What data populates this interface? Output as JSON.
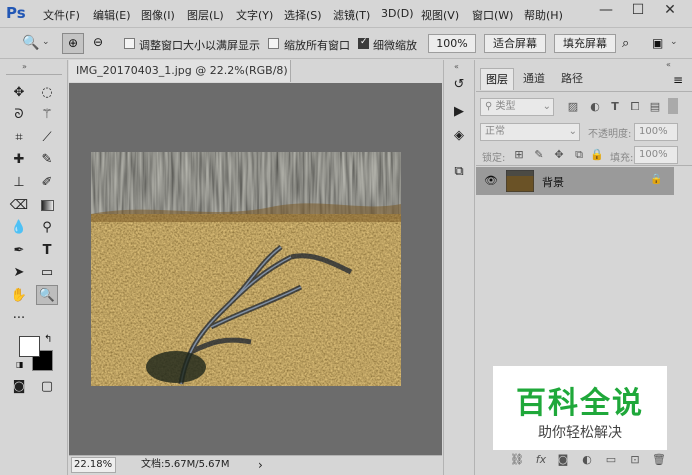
{
  "app": {
    "logo": "Ps"
  },
  "menu": [
    "文件(F)",
    "编辑(E)",
    "图像(I)",
    "图层(L)",
    "文字(Y)",
    "选择(S)",
    "滤镜(T)",
    "3D(D)",
    "视图(V)",
    "窗口(W)",
    "帮助(H)"
  ],
  "window_controls": {
    "minimize": "—",
    "maximize": "☐",
    "close": "✕"
  },
  "options": {
    "resize_windows_label": "调整窗口大小以满屏显示",
    "resize_windows_checked": false,
    "zoom_all_label": "缩放所有窗口",
    "zoom_all_checked": false,
    "scrubby_zoom_label": "细微缩放",
    "scrubby_zoom_checked": true,
    "zoom_value": "100%",
    "fit_screen_label": "适合屏幕",
    "fill_screen_label": "填充屏幕"
  },
  "document": {
    "tab_title": "IMG_20170403_1.jpg @ 22.2%(RGB/8) *",
    "tab_close": "×",
    "zoom": "22.18%",
    "doc_info": "文档:5.67M/5.67M",
    "arrow": "›"
  },
  "layers_panel": {
    "tabs": [
      "图层",
      "通道",
      "路径"
    ],
    "filter_kind": "类型",
    "blend_mode": "正常",
    "opacity_label": "不透明度:",
    "opacity_value": "100%",
    "lock_label": "锁定:",
    "fill_label": "填充:",
    "fill_value": "100%",
    "layers": [
      {
        "name": "背景",
        "visible": true,
        "locked": true
      }
    ]
  },
  "watermark": {
    "title": "百科全说",
    "subtitle": "助你轻松解决"
  },
  "colors": {
    "accent": "#2257b5",
    "watermark_green": "#1fa83a",
    "canvas_bg": "#6c6c6c",
    "panel_bg": "#d6d6d6"
  }
}
